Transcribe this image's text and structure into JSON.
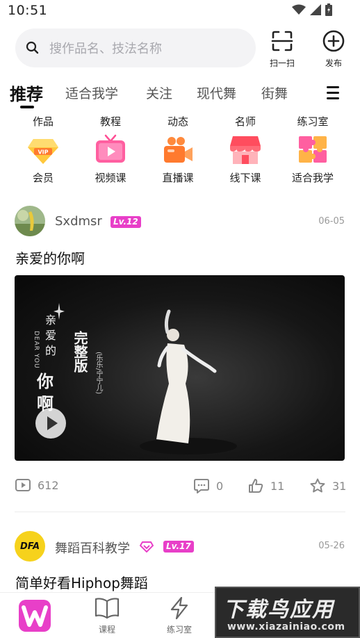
{
  "status_bar": {
    "time": "10:51"
  },
  "search": {
    "placeholder": "搜作品名、技法名称"
  },
  "top_actions": {
    "scan_label": "扫一扫",
    "publish_label": "发布"
  },
  "tabs": [
    {
      "label": "推荐",
      "active": true
    },
    {
      "label": "适合我学"
    },
    {
      "label": "关注"
    },
    {
      "label": "现代舞"
    },
    {
      "label": "街舞"
    }
  ],
  "subnav": [
    "作品",
    "教程",
    "动态",
    "名师",
    "练习室"
  ],
  "categories": [
    {
      "label": "会员",
      "icon": "vip-diamond-icon"
    },
    {
      "label": "视频课",
      "icon": "tv-play-icon"
    },
    {
      "label": "直播课",
      "icon": "camera-live-icon"
    },
    {
      "label": "线下课",
      "icon": "storefront-icon"
    },
    {
      "label": "适合我学",
      "icon": "puzzle-icon"
    }
  ],
  "posts": [
    {
      "username": "Sxdmsr",
      "level": "Lv.12",
      "date": "06-05",
      "title": "亲爱的你啊",
      "video": {
        "vertical_title": [
          "亲",
          "爱",
          "的",
          "你",
          "啊"
        ],
        "subtitle_en": "DEAR YOU",
        "tag": "完整版",
        "credit": "(乐乐/宁宁儿)"
      },
      "stats": {
        "views": "612",
        "comments": "0",
        "likes": "11",
        "favorites": "31"
      }
    },
    {
      "username": "舞蹈百科教学",
      "level": "Lv.17",
      "date": "05-26",
      "title": "简单好看Hiphop舞蹈",
      "avatar_text": "DFA"
    }
  ],
  "bottom_nav": [
    {
      "label": "课程"
    },
    {
      "label": "练习室"
    }
  ],
  "watermark": {
    "title": "下载鸟应用",
    "url": "www.xiazainiao.com"
  },
  "colors": {
    "level_badge": "#e83fc8",
    "accent_pink": "#ff4fa3"
  }
}
